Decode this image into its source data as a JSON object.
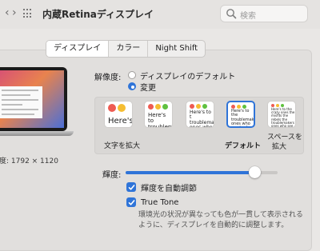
{
  "window": {
    "title": "内蔵Retinaディスプレイ",
    "back_glyph": "‹",
    "forward_glyph": "›"
  },
  "search": {
    "placeholder": "検索"
  },
  "tabs": [
    {
      "label": "ディスプレイ",
      "active": true
    },
    {
      "label": "カラー",
      "active": false
    },
    {
      "label": "Night Shift",
      "active": false
    }
  ],
  "display": {
    "resolution_text": "度: 1792 × 1120"
  },
  "resolution": {
    "label": "解像度:",
    "options": [
      {
        "label": "ディスプレイのデフォルト",
        "checked": false
      },
      {
        "label": "変更",
        "checked": true
      }
    ]
  },
  "scaling": {
    "options": [
      {
        "text": "Here's",
        "selected": false
      },
      {
        "text": "Here's to troublemak",
        "selected": false
      },
      {
        "text": "Here's to t troublemak ones who",
        "selected": false
      },
      {
        "text": "Here's to the troublemakers ones who see t rules. And th",
        "selected": true
      },
      {
        "text": "Here's to the crazy ones the misfits the rebels the troublemakers ones who see things differently rules",
        "selected": false
      }
    ],
    "labels": {
      "larger": "文字を拡大",
      "default": "デフォルト",
      "more_space_line1": "スペースを",
      "more_space_line2": "拡大"
    }
  },
  "brightness": {
    "label": "輝度:",
    "level_percent": 85
  },
  "auto_brightness": {
    "label": "輝度を自動調節",
    "checked": true
  },
  "true_tone": {
    "label": "True Tone",
    "checked": true,
    "description_line1": "環境光の状況が異なっても色が一貫して表示される",
    "description_line2": "ように、ディスプレイを自動的に調整します。"
  },
  "colors": {
    "accent": "#2f74d8",
    "traffic_red": "#ee5b52",
    "traffic_yellow": "#f5bd31",
    "traffic_green": "#5fc13f"
  }
}
